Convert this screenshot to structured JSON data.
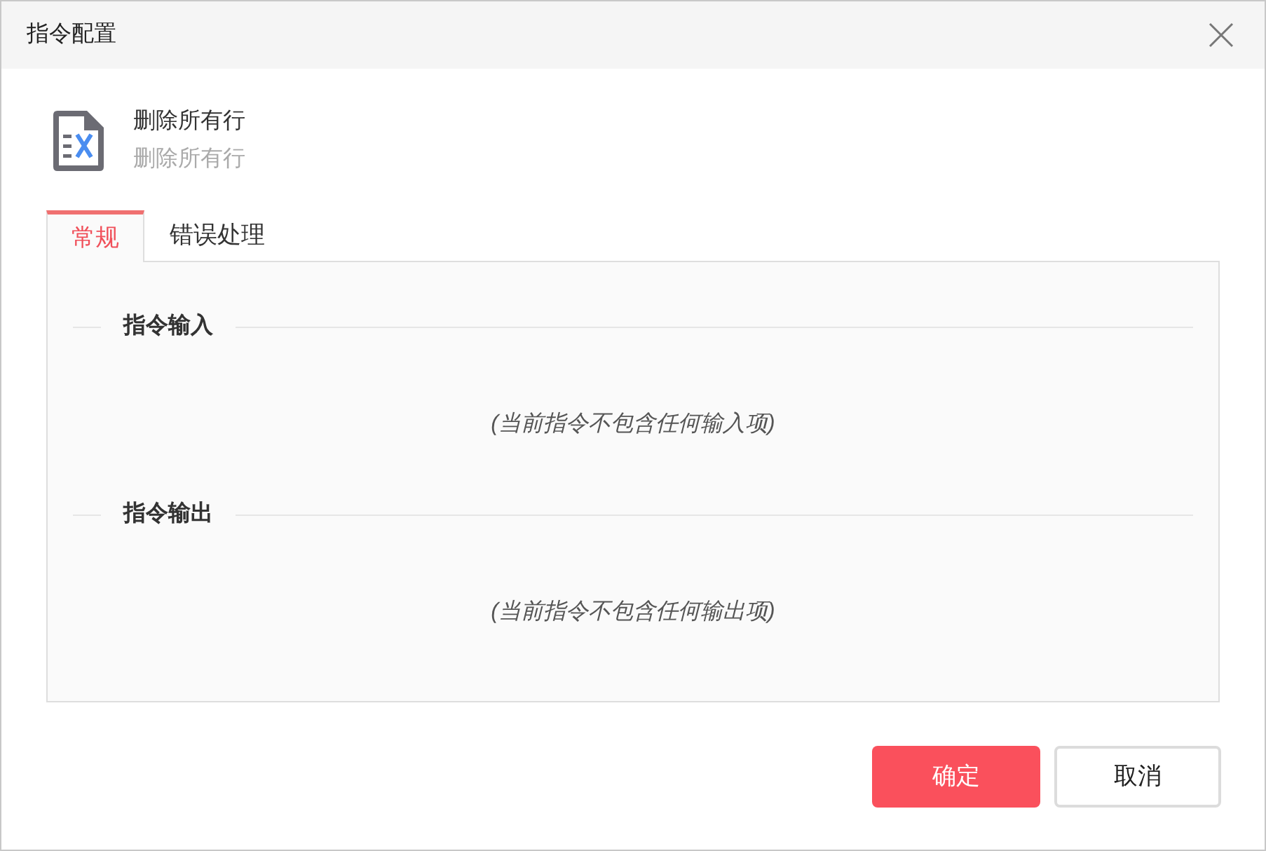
{
  "window": {
    "title": "指令配置"
  },
  "command": {
    "name": "删除所有行",
    "description": "删除所有行"
  },
  "tabs": [
    {
      "label": "常规",
      "selected": true
    },
    {
      "label": "错误处理",
      "selected": false
    }
  ],
  "sections": [
    {
      "title": "指令输入",
      "empty_text": "(当前指令不包含任何输入项)"
    },
    {
      "title": "指令输出",
      "empty_text": "(当前指令不包含任何输出项)"
    }
  ],
  "buttons": [
    {
      "label": "确定",
      "kind": "primary"
    },
    {
      "label": "取消",
      "kind": "default"
    }
  ]
}
